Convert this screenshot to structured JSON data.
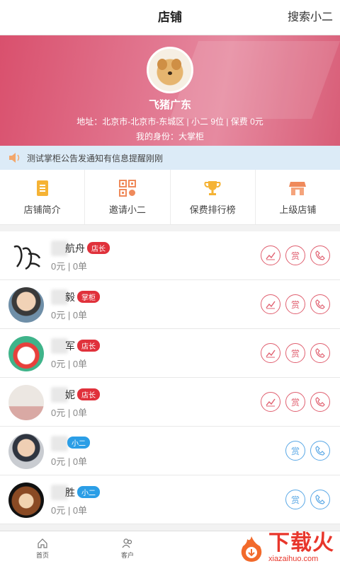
{
  "header": {
    "title": "店铺",
    "right_link": "搜索小二"
  },
  "shop": {
    "name": "飞猪广东",
    "info": "地址：北京市-北京市-东城区 | 小二 9位 | 保费 0元",
    "role": "我的身份：大掌柜"
  },
  "notice": {
    "text": "测试掌柜公告发通知有信息提醒刚刚"
  },
  "menu": [
    {
      "label": "店铺简介",
      "icon": "document-icon"
    },
    {
      "label": "邀请小二",
      "icon": "qrcode-icon"
    },
    {
      "label": "保费排行榜",
      "icon": "trophy-icon"
    },
    {
      "label": "上级店铺",
      "icon": "store-icon"
    }
  ],
  "members": [
    {
      "name": "航舟",
      "badge": "店长",
      "badge_type": "red",
      "stats": "0元 | 0单",
      "actions": [
        "trend",
        "reward",
        "phone"
      ]
    },
    {
      "name": "毅",
      "badge": "掌柜",
      "badge_type": "red",
      "stats": "0元 | 0单",
      "actions": [
        "trend",
        "reward",
        "phone"
      ]
    },
    {
      "name": "军",
      "badge": "店长",
      "badge_type": "red",
      "stats": "0元 | 0单",
      "actions": [
        "trend",
        "reward",
        "phone"
      ]
    },
    {
      "name": "妮",
      "badge": "店长",
      "badge_type": "red",
      "stats": "0元 | 0单",
      "actions": [
        "trend",
        "reward",
        "phone"
      ]
    },
    {
      "name": "",
      "badge": "小二",
      "badge_type": "blue",
      "stats": "0元 | 0单",
      "actions": [
        "reward",
        "phone"
      ]
    },
    {
      "name": "胜",
      "badge": "小二",
      "badge_type": "blue",
      "stats": "0元 | 0单",
      "actions": [
        "reward",
        "phone"
      ]
    }
  ],
  "reward_label": "赏",
  "tabbar": [
    {
      "label": "首页",
      "icon": "home-icon"
    },
    {
      "label": "客户",
      "icon": "customers-icon"
    }
  ],
  "watermark": {
    "cn": "下载火",
    "en": "xiazaihuo.com"
  }
}
